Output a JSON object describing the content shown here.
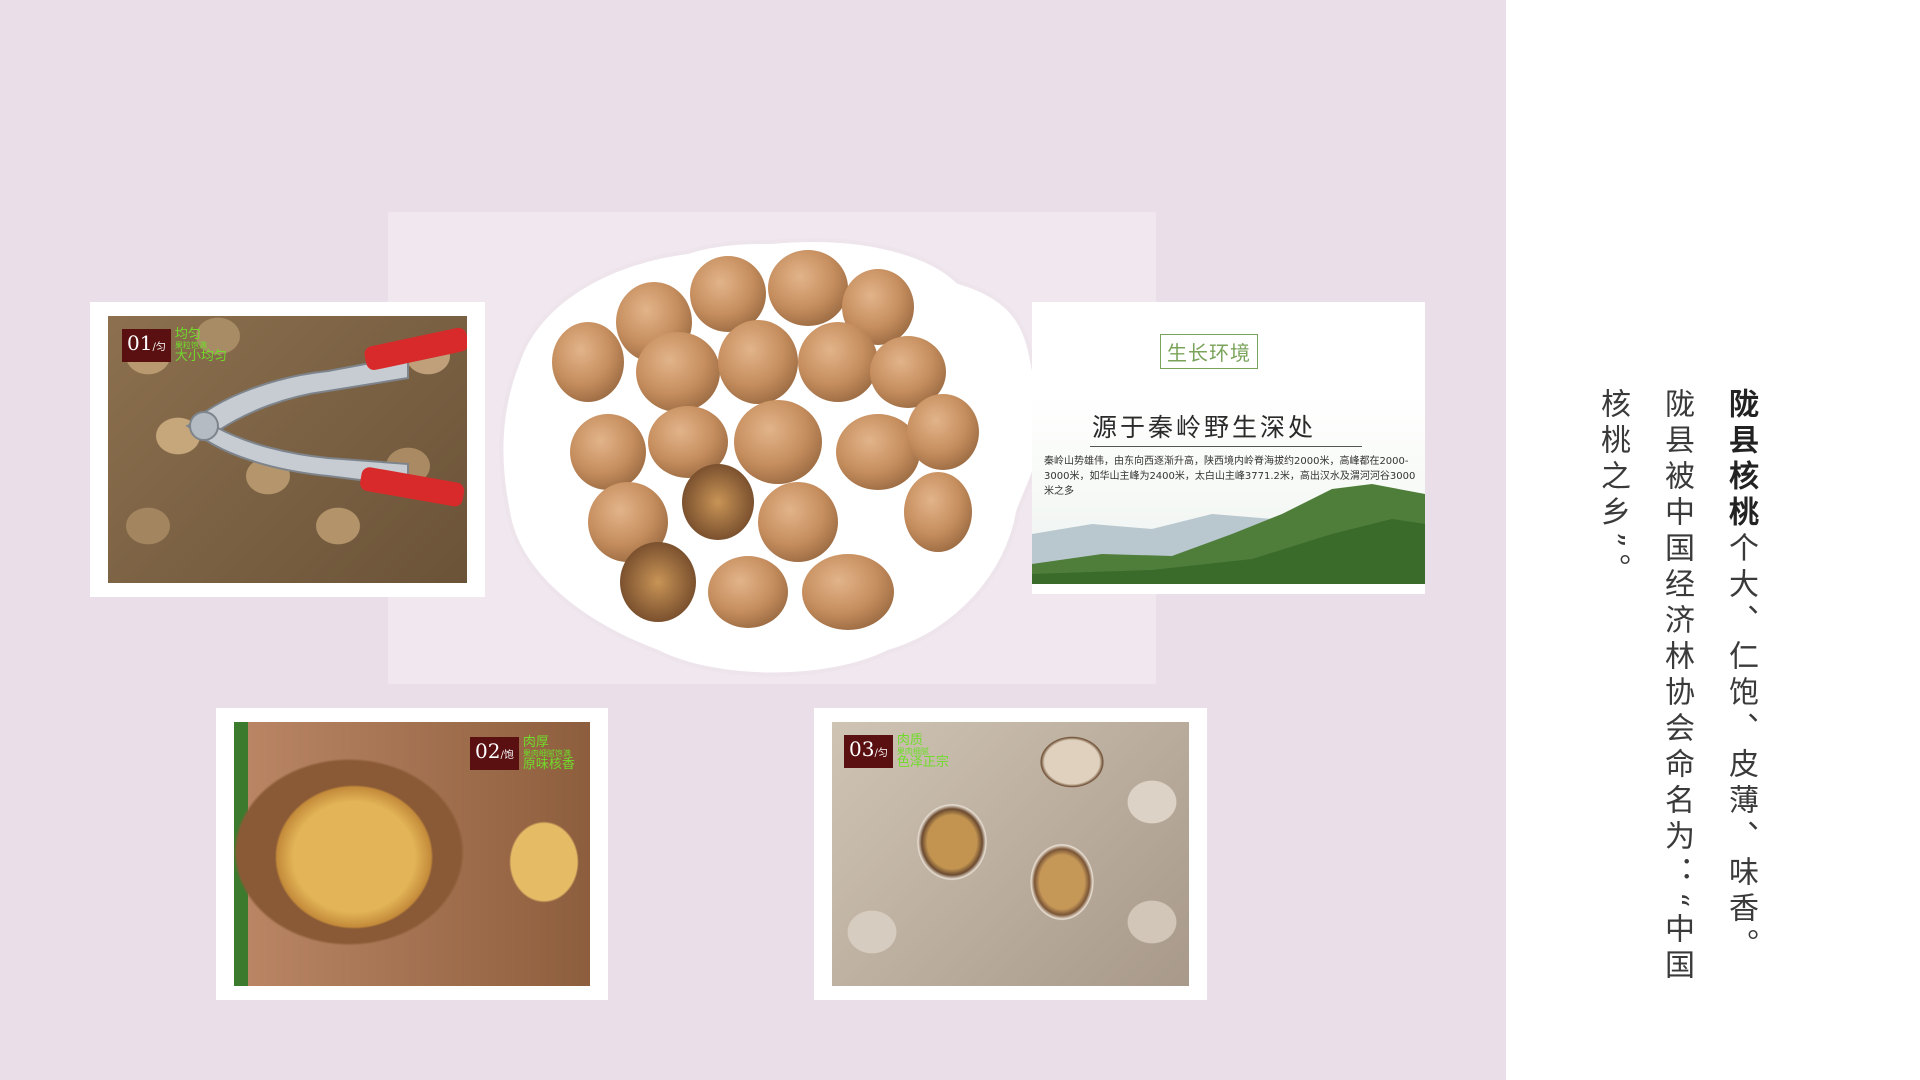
{
  "slide": {
    "heading": "陇县核桃",
    "body": "个大、仁饱、皮薄、味香。陇县被中国经济林协会命名为：“中国核桃之乡”。"
  },
  "cards": {
    "c1": {
      "number": "01",
      "unit": "/匀",
      "line1": "均匀",
      "line2": "果粒饱满",
      "line3": "大小均匀"
    },
    "c2": {
      "number": "02",
      "unit": "/饱",
      "line1": "肉厚",
      "line2": "果肉细腻饱满",
      "line3": "原味核香"
    },
    "c3": {
      "number": "03",
      "unit": "/匀",
      "line1": "肉质",
      "line2": "果肉细腻",
      "line3": "色泽正宗"
    }
  },
  "environment": {
    "tag": "生长环境",
    "title": "源于秦岭野生深处",
    "desc": "秦岭山势雄伟，由东向西逐渐升高，陕西境内岭脊海拔约2000米，高峰都在2000-3000米，如华山主峰为2400米，太白山主峰3771.2米，高出汉水及渭河河谷3000米之多"
  },
  "colors": {
    "panel": "#eadfe8",
    "badge": "#5a1010",
    "label_green": "#6fdc2a",
    "tag_green": "#7aa35a"
  }
}
